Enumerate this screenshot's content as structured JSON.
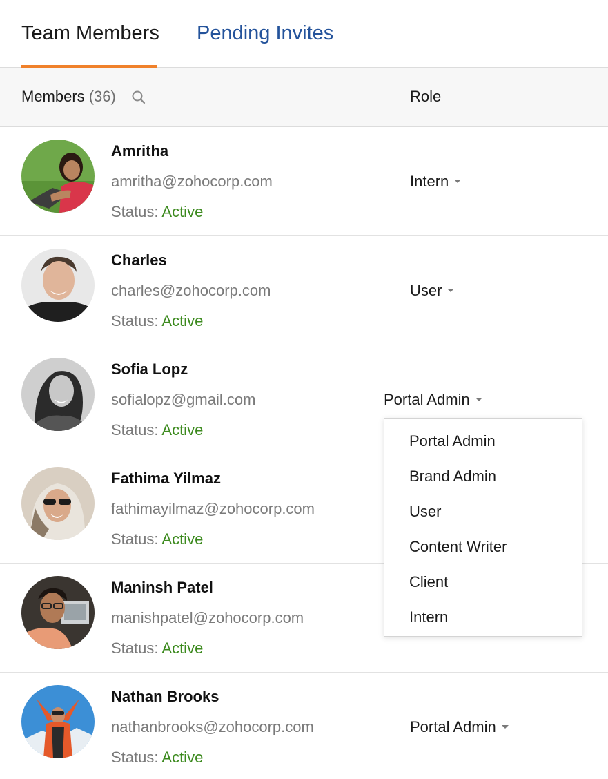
{
  "tabs": {
    "team_members": "Team Members",
    "pending_invites": "Pending Invites"
  },
  "header": {
    "members_label": "Members",
    "members_count": "(36)",
    "role_label": "Role"
  },
  "status_label": "Status:",
  "members": [
    {
      "name": "Amritha",
      "email": "amritha@zohocorp.com",
      "status": "Active",
      "role": "Intern"
    },
    {
      "name": "Charles",
      "email": "charles@zohocorp.com",
      "status": "Active",
      "role": "User"
    },
    {
      "name": "Sofia Lopz",
      "email": "sofialopz@gmail.com",
      "status": "Active",
      "role": "Portal Admin"
    },
    {
      "name": "Fathima Yilmaz",
      "email": "fathimayilmaz@zohocorp.com",
      "status": "Active",
      "role": ""
    },
    {
      "name": "Maninsh Patel",
      "email": "manishpatel@zohocorp.com",
      "status": "Active",
      "role": ""
    },
    {
      "name": "Nathan Brooks",
      "email": "nathanbrooks@zohocorp.com",
      "status": "Active",
      "role": "Portal Admin"
    }
  ],
  "role_dropdown": {
    "options": [
      "Portal Admin",
      "Brand Admin",
      "User",
      "Content Writer",
      "Client",
      "Intern"
    ]
  },
  "colors": {
    "accent_tab_underline": "#f0812b",
    "link_tab": "#24539b",
    "status_active": "#3c8a1e"
  }
}
